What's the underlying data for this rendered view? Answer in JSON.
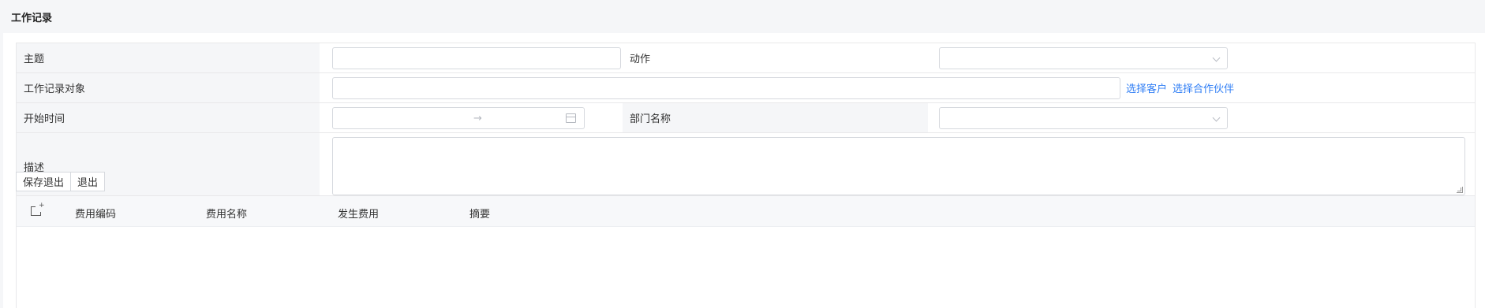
{
  "page": {
    "title": "工作记录"
  },
  "form": {
    "subject_label": "主题",
    "subject_value": "",
    "action_label": "动作",
    "action_value": "",
    "target_label": "工作记录对象",
    "target_value": "",
    "select_customer_link": "选择客户",
    "select_partner_link": "选择合作伙伴",
    "start_time_label": "开始时间",
    "start_time_arrow": "→",
    "dept_label": "部门名称",
    "dept_value": "",
    "description_label": "描述",
    "description_value": ""
  },
  "buttons": {
    "save_exit": "保存退出",
    "exit": "退出"
  },
  "table": {
    "columns": [
      "费用编码",
      "费用名称",
      "发生费用",
      "摘要"
    ],
    "rows": []
  },
  "icons": {
    "add_row": "add-row-icon",
    "calendar": "calendar-icon",
    "chevron": "chevron-down-icon",
    "arrow": "arrow-right-icon"
  },
  "colors": {
    "link": "#2f7ef5",
    "label_bg": "#f5f6f8",
    "border": "#e8e8ea"
  }
}
